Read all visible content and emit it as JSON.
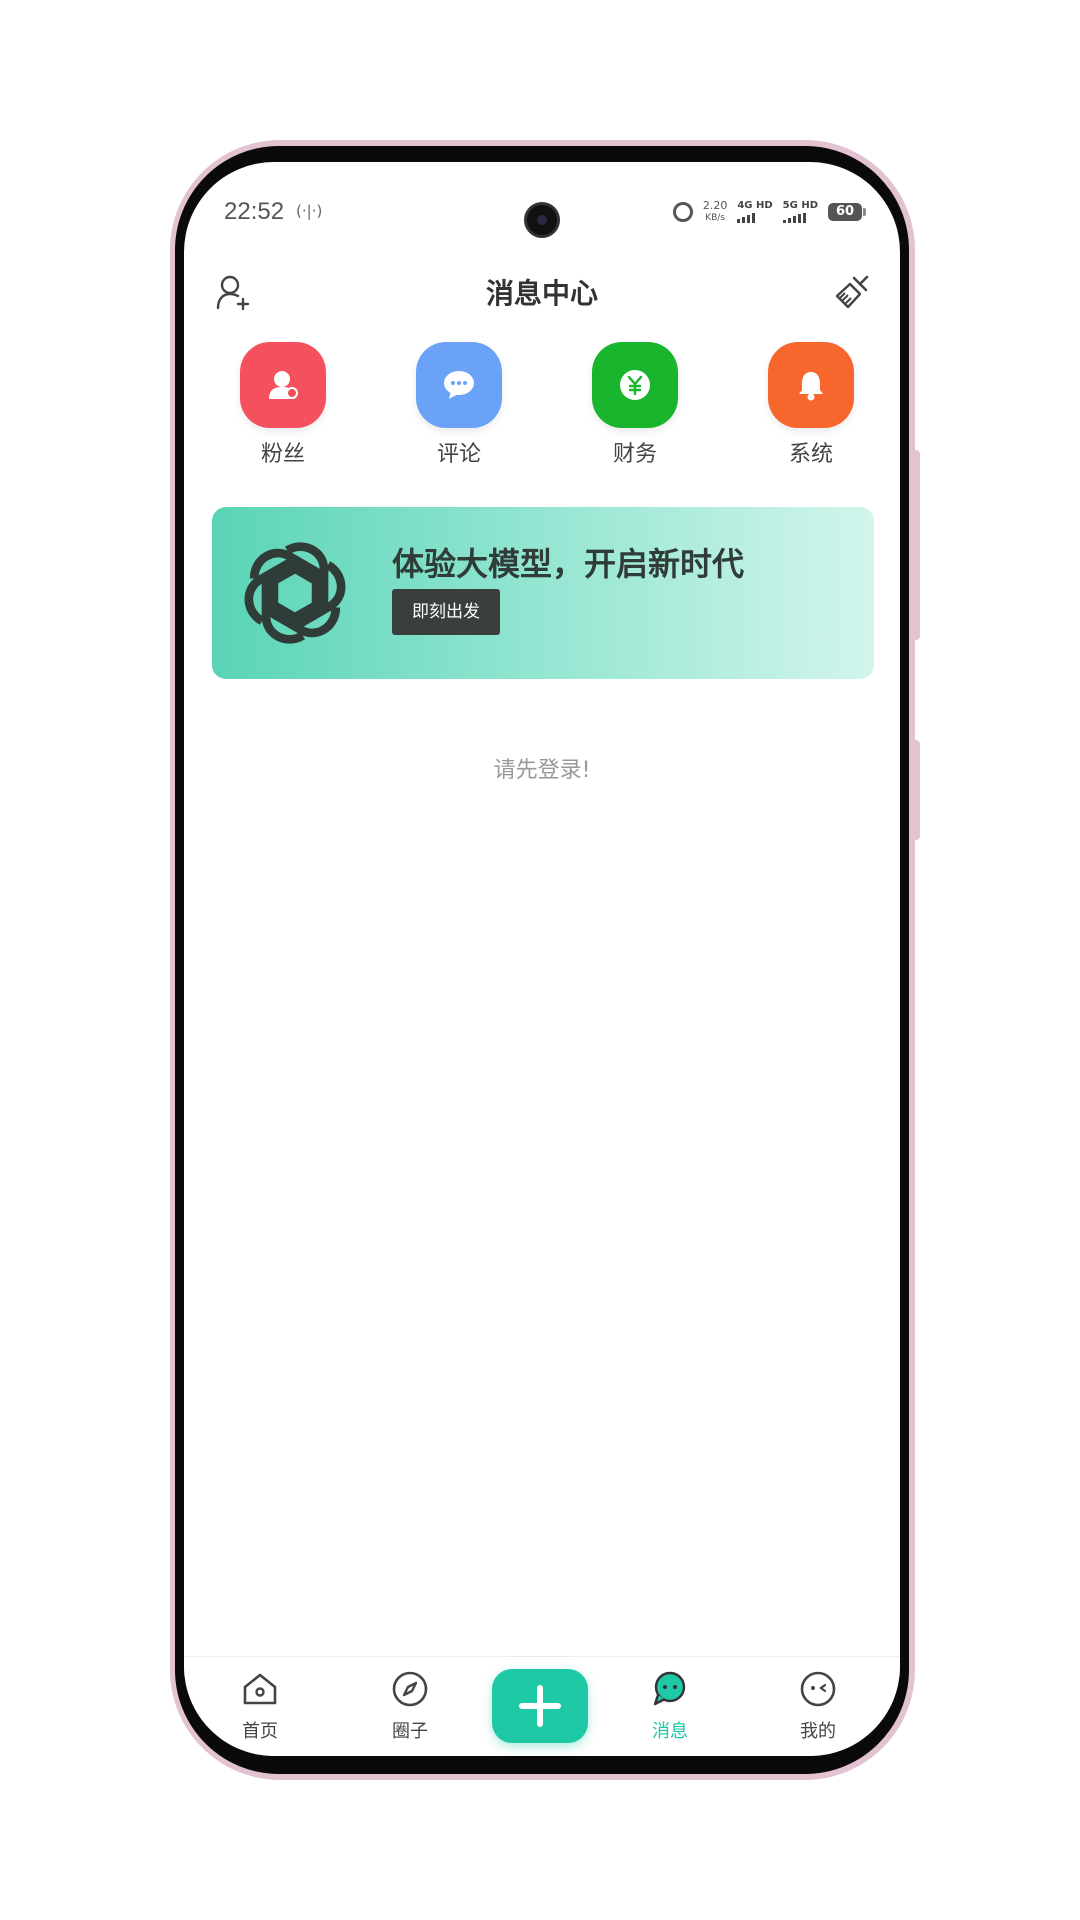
{
  "status_bar": {
    "time": "22:52",
    "nfc": "(·|·)",
    "net_speed_value": "2.20",
    "net_speed_unit": "KB/s",
    "sim1_label": "4G HD",
    "sim2_label": "5G HD",
    "battery": "60"
  },
  "header": {
    "title": "消息中心"
  },
  "categories": [
    {
      "label": "粉丝",
      "color": "#f5505e",
      "icon": "fans-icon"
    },
    {
      "label": "评论",
      "color": "#6aa2f8",
      "icon": "comment-icon"
    },
    {
      "label": "财务",
      "color": "#19b52c",
      "icon": "finance-icon"
    },
    {
      "label": "系统",
      "color": "#f7662d",
      "icon": "system-bell-icon"
    }
  ],
  "banner": {
    "title": "体验大模型，开启新时代",
    "button": "即刻出发"
  },
  "empty_hint": "请先登录!",
  "tabbar": {
    "items": [
      {
        "label": "首页",
        "icon": "home-icon"
      },
      {
        "label": "圈子",
        "icon": "compass-icon"
      },
      {
        "label": "消息",
        "icon": "message-icon",
        "active": true
      },
      {
        "label": "我的",
        "icon": "profile-icon"
      }
    ],
    "accent": "#1fc9a5"
  }
}
